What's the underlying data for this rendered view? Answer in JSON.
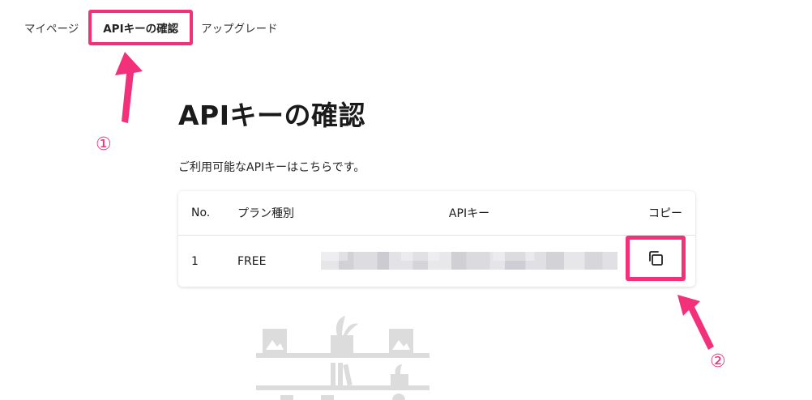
{
  "nav": {
    "items": [
      {
        "label": "マイページ"
      },
      {
        "label": "APIキーの確認"
      },
      {
        "label": "アップグレード"
      }
    ]
  },
  "main": {
    "title": "APIキーの確認",
    "description": "ご利用可能なAPIキーはこちらです。"
  },
  "table": {
    "headers": [
      "No.",
      "プラン種別",
      "APIキー",
      "コピー"
    ],
    "rows": [
      {
        "no": "1",
        "plan": "FREE"
      }
    ]
  },
  "annotations": {
    "marker1": "①",
    "marker2": "②",
    "color": "#f2317a"
  },
  "icons": {
    "copy": "copy-icon"
  }
}
